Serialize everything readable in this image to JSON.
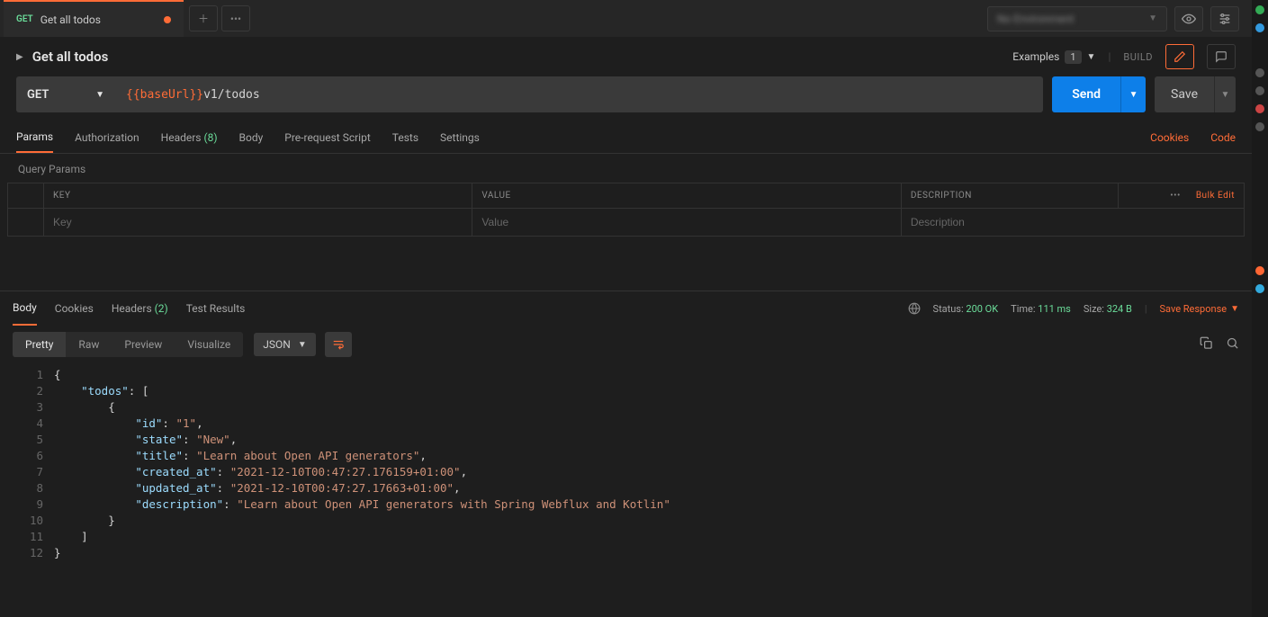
{
  "tab": {
    "method": "GET",
    "title": "Get all todos"
  },
  "request": {
    "title": "Get all todos",
    "method": "GET",
    "urlVar": "{{baseUrl}}",
    "urlPath": "v1/todos"
  },
  "titleRight": {
    "examples": "Examples",
    "examplesCount": "1",
    "build": "BUILD"
  },
  "actions": {
    "send": "Send",
    "save": "Save"
  },
  "reqTabs": {
    "params": "Params",
    "authorization": "Authorization",
    "headers": "Headers",
    "headersCount": "(8)",
    "body": "Body",
    "preRequest": "Pre-request Script",
    "tests": "Tests",
    "settings": "Settings",
    "cookies": "Cookies",
    "code": "Code"
  },
  "paramSection": {
    "label": "Query Params"
  },
  "paramTable": {
    "keyHeader": "KEY",
    "valueHeader": "VALUE",
    "descHeader": "DESCRIPTION",
    "bulkEdit": "Bulk Edit",
    "keyPh": "Key",
    "valuePh": "Value",
    "descPh": "Description"
  },
  "respTabs": {
    "body": "Body",
    "cookies": "Cookies",
    "headers": "Headers",
    "headersCount": "(2)",
    "testResults": "Test Results"
  },
  "respMeta": {
    "statusLabel": "Status:",
    "statusValue": "200 OK",
    "timeLabel": "Time:",
    "timeValue": "111 ms",
    "sizeLabel": "Size:",
    "sizeValue": "324 B",
    "saveResponse": "Save Response"
  },
  "viewRow": {
    "pretty": "Pretty",
    "raw": "Raw",
    "preview": "Preview",
    "visualize": "Visualize",
    "format": "JSON"
  },
  "responseBody": {
    "todos": [
      {
        "id": "1",
        "state": "New",
        "title": "Learn about Open API generators",
        "created_at": "2021-12-10T00:47:27.176159+01:00",
        "updated_at": "2021-12-10T00:47:27.17663+01:00",
        "description": "Learn about Open API generators with Spring Webflux and Kotlin"
      }
    ]
  },
  "env": {
    "placeholder": "No Environment"
  }
}
